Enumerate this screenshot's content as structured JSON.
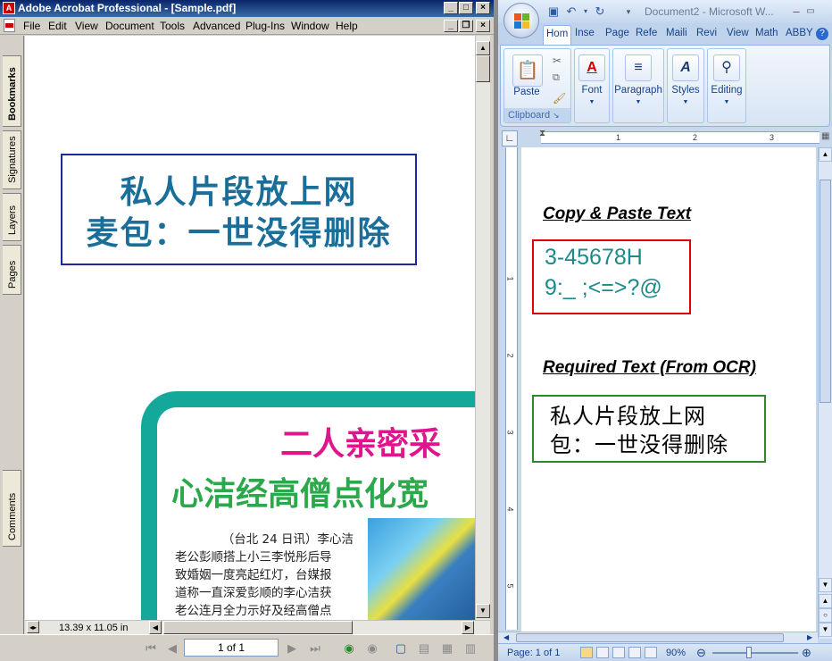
{
  "acrobat": {
    "title": "Adobe Acrobat Professional - [Sample.pdf]",
    "menu": [
      "File",
      "Edit",
      "View",
      "Document",
      "Tools",
      "Advanced",
      "Plug-Ins",
      "Window",
      "Help"
    ],
    "nav_tabs": [
      "Bookmarks",
      "Signatures",
      "Layers",
      "Pages",
      "Comments"
    ],
    "page_title_lines": [
      "私人片段放上网",
      "麦包：一世没得删除"
    ],
    "news_headline_1": "二人亲密采",
    "news_headline_2": "心洁经高僧点化宽",
    "news_body": [
      "（台北 24 日讯）李心洁",
      "老公彭顺搭上小三李悦彤后导",
      "致婚姻一度亮起红灯，台媒报",
      "道称一直深爱彭顺的李心洁获",
      "老公连月全力示好及经高僧点"
    ],
    "page_size": "13.39 x 11.05 in",
    "page_indicator": "1 of 1"
  },
  "word": {
    "title": "Document2 - Microsoft W...",
    "tabs": [
      "Hom",
      "Inse",
      "Page",
      "Refe",
      "Maili",
      "Revi",
      "View",
      "Math",
      "ABBY"
    ],
    "groups": {
      "paste": "Paste",
      "clipboard": "Clipboard",
      "font": "Font",
      "paragraph": "Paragraph",
      "styles": "Styles",
      "editing": "Editing"
    },
    "ruler_numbers": [
      "1",
      "2",
      "3"
    ],
    "vruler_numbers": [
      "1",
      "2",
      "3",
      "4",
      "5"
    ],
    "heading_1": "Copy & Paste Text",
    "pasted_lines": [
      "3-45678H",
      "9:_ ;<=>?@"
    ],
    "heading_2": "Required Text (From OCR)",
    "ocr_lines": [
      "私人片段放上网",
      "包：一世没得删除"
    ],
    "status_page": "Page: 1 of 1",
    "zoom": "90%"
  },
  "colors": {
    "acrobat_title": "#0a246a",
    "pdf_title_text": "#1a6f9a",
    "pdf_title_border": "#1a2a9a",
    "headline_magenta": "#e0148c",
    "headline_green": "#2aa84a",
    "frame_teal": "#14a89a",
    "red_box": "#dd0000",
    "green_box": "#2a8a2a",
    "pasted_text": "#1c8a8a"
  }
}
